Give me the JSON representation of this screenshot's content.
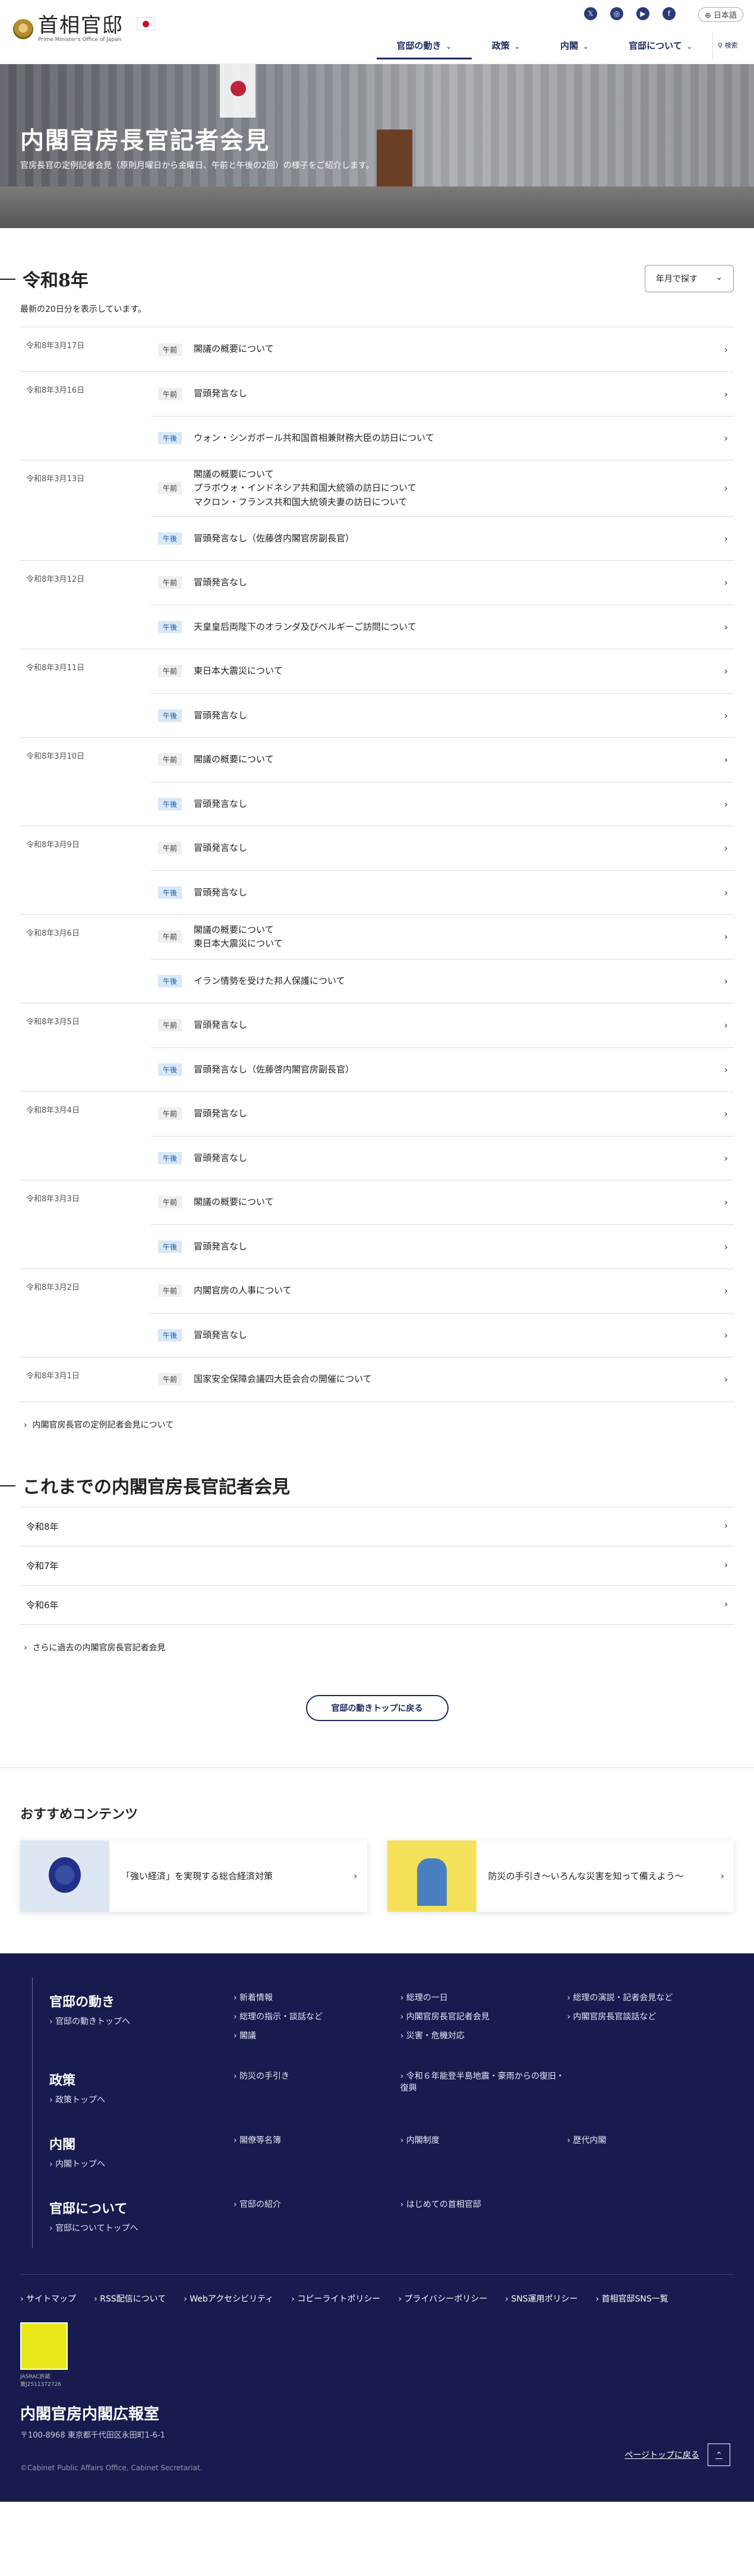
{
  "header": {
    "logo_title": "首相官邸",
    "logo_sub": "Prime Minister's Office of Japan",
    "lang": "日本語",
    "nav": [
      {
        "label": "官邸の動き"
      },
      {
        "label": "政策"
      },
      {
        "label": "内閣"
      },
      {
        "label": "官邸について"
      }
    ],
    "search": "検索"
  },
  "hero": {
    "title": "内閣官房長官記者会見",
    "desc": "官房長官の定例記者会見（原則月曜日から金曜日、午前と午後の2回）の様子をご紹介します。"
  },
  "current": {
    "year": "令和8年",
    "select": "年月で探す",
    "count": "最新の20日分を表示しています。"
  },
  "entries": [
    {
      "date": "令和8年3月17日",
      "items": [
        {
          "tag": "午前",
          "text": "閣議の概要について"
        }
      ]
    },
    {
      "date": "令和8年3月16日",
      "items": [
        {
          "tag": "午前",
          "text": "冒頭発言なし"
        },
        {
          "tag": "午後",
          "text": "ウォン・シンガポール共和国首相兼財務大臣の訪日について"
        }
      ]
    },
    {
      "date": "令和8年3月13日",
      "items": [
        {
          "tag": "午前",
          "text": "閣議の概要について\nプラボウォ・インドネシア共和国大統領の訪日について\nマクロン・フランス共和国大統領夫妻の訪日について"
        },
        {
          "tag": "午後",
          "text": "冒頭発言なし（佐藤啓内閣官房副長官）"
        }
      ]
    },
    {
      "date": "令和8年3月12日",
      "items": [
        {
          "tag": "午前",
          "text": "冒頭発言なし"
        },
        {
          "tag": "午後",
          "text": "天皇皇后両陛下のオランダ及びベルギーご訪問について"
        }
      ]
    },
    {
      "date": "令和8年3月11日",
      "items": [
        {
          "tag": "午前",
          "text": "東日本大震災について"
        },
        {
          "tag": "午後",
          "text": "冒頭発言なし"
        }
      ]
    },
    {
      "date": "令和8年3月10日",
      "items": [
        {
          "tag": "午前",
          "text": "閣議の概要について"
        },
        {
          "tag": "午後",
          "text": "冒頭発言なし"
        }
      ]
    },
    {
      "date": "令和8年3月9日",
      "items": [
        {
          "tag": "午前",
          "text": "冒頭発言なし"
        },
        {
          "tag": "午後",
          "text": "冒頭発言なし"
        }
      ]
    },
    {
      "date": "令和8年3月6日",
      "items": [
        {
          "tag": "午前",
          "text": "閣議の概要について\n東日本大震災について"
        },
        {
          "tag": "午後",
          "text": "イラン情勢を受けた邦人保護について"
        }
      ]
    },
    {
      "date": "令和8年3月5日",
      "items": [
        {
          "tag": "午前",
          "text": "冒頭発言なし"
        },
        {
          "tag": "午後",
          "text": "冒頭発言なし（佐藤啓内閣官房副長官）"
        }
      ]
    },
    {
      "date": "令和8年3月4日",
      "items": [
        {
          "tag": "午前",
          "text": "冒頭発言なし"
        },
        {
          "tag": "午後",
          "text": "冒頭発言なし"
        }
      ]
    },
    {
      "date": "令和8年3月3日",
      "items": [
        {
          "tag": "午前",
          "text": "閣議の概要について"
        },
        {
          "tag": "午後",
          "text": "冒頭発言なし"
        }
      ]
    },
    {
      "date": "令和8年3月2日",
      "items": [
        {
          "tag": "午前",
          "text": "内閣官房の人事について"
        },
        {
          "tag": "午後",
          "text": "冒頭発言なし"
        }
      ]
    },
    {
      "date": "令和8年3月1日",
      "items": [
        {
          "tag": "午前",
          "text": "国家安全保障会議四大臣会合の開催について"
        }
      ]
    }
  ],
  "about_link": "内閣官房長官の定例記者会見について",
  "past": {
    "title": "これまでの内閣官房長官記者会見",
    "years": [
      "令和8年",
      "令和7年",
      "令和6年"
    ],
    "more": "さらに過去の内閣官房長官記者会見"
  },
  "back_button": "官邸の動きトップに戻る",
  "recommend": {
    "title": "おすすめコンテンツ",
    "cards": [
      {
        "text": "「強い経済」を実現する総合経済対策"
      },
      {
        "text": "防災の手引き〜いろんな災害を知って備えよう〜"
      }
    ]
  },
  "footer": {
    "sections": [
      {
        "title": "官邸の動き",
        "top": "官邸の動きトップへ",
        "links": [
          "新着情報",
          "総理の一日",
          "総理の演説・記者会見など",
          "総理の指示・談話など",
          "内閣官房長官記者会見",
          "内閣官房長官談話など",
          "閣議",
          "災害・危機対応"
        ]
      },
      {
        "title": "政策",
        "top": "政策トップへ",
        "links": [
          "防災の手引き",
          "令和６年能登半島地震・豪雨からの復旧・復興"
        ]
      },
      {
        "title": "内閣",
        "top": "内閣トップへ",
        "links": [
          "閣僚等名簿",
          "内閣制度",
          "歴代内閣"
        ]
      },
      {
        "title": "官邸について",
        "top": "官邸についてトップへ",
        "links": [
          "官邸の紹介",
          "はじめての首相官邸"
        ]
      }
    ],
    "bottom_links": [
      "サイトマップ",
      "RSS配信について",
      "Webアクセシビリティ",
      "コピーライトポリシー",
      "プライバシーポリシー",
      "SNS運用ポリシー",
      "首相官邸SNS一覧"
    ],
    "badge_sub": "JASRAC許諾\n第J2511372726",
    "org": "内閣官房内閣広報室",
    "address": "〒100-8968 東京都千代田区永田町1-6-1",
    "copyright": "©Cabinet Public Affairs Office, Cabinet Secretariat.",
    "pagetop": "ページトップに戻る"
  },
  "colors": {
    "navy": "#171b4d",
    "accent": "#1b2a5e",
    "pm_tag": "#d8e9f8"
  }
}
